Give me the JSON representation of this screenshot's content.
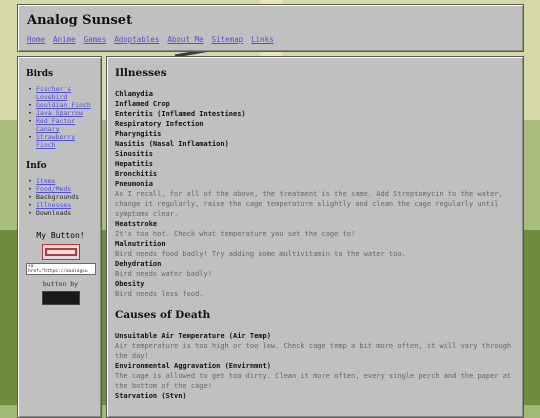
{
  "site": {
    "title": "Analog Sunset",
    "nav": [
      "Home",
      "Anime",
      "Games",
      "Adoptables",
      "About Me",
      "Sitemap",
      "Links"
    ]
  },
  "sidebar": {
    "birds_heading": "Birds",
    "birds": [
      "Fischer's Lovebird",
      "Gouldian Finch",
      "Java Sparrow",
      "Red Factor Canary",
      "Strawberry Finch"
    ],
    "info_heading": "Info",
    "info": [
      {
        "label": "Items",
        "link": true
      },
      {
        "label": "Food/Meds",
        "link": true
      },
      {
        "label": "Backgrounds",
        "link": false
      },
      {
        "label": "Illnesses",
        "link": true
      },
      {
        "label": "Downloads",
        "link": false
      }
    ],
    "my_button_heading": "My Button!",
    "button_code": "<a href=\"https://analogsu",
    "button_by": "button by"
  },
  "main": {
    "illnesses_heading": "Illnesses",
    "illness_list": [
      "Chlamydia",
      "Inflamed Crop",
      "Enteritis (Inflamed Intestines)",
      "Respiratory Infection",
      "Pharyngitis",
      "Nasitis (Nasal Inflamation)",
      "Sinusitis",
      "Hepatitis",
      "Bronchitis",
      "Pneumonia"
    ],
    "illness_note": "As I recall, for all of the above, the treatment is the same. Add Streptomycin to the water, change it regularly, raise the cage temperature slightly and clean the cage regularly until symptoms clear.",
    "other_illnesses": [
      {
        "title": "Heatstroke",
        "desc": "It's too hot. Check what temperature you set the cage to!"
      },
      {
        "title": "Malnutrition",
        "desc": "Bird needs food badly! Try adding some multivitamin to the water too."
      },
      {
        "title": "Dehydration",
        "desc": "Bird needs water badly!"
      },
      {
        "title": "Obesity",
        "desc": "Bird needs less food."
      }
    ],
    "death_heading": "Causes of Death",
    "death_causes": [
      {
        "title": "Unsuitable Air Temperature (Air Temp)",
        "desc": "Air temperature is too high or too low. Check cage temp a bit more often, it will vary through the day!"
      },
      {
        "title": "Environmental Aggravation (Envirnmnt)",
        "desc": "The cage is allowed to get too dirty. Clean it more often, every single perch and the paper at the bottom of the cage!"
      },
      {
        "title": "Starvation (Stvn)",
        "desc": ""
      }
    ]
  }
}
